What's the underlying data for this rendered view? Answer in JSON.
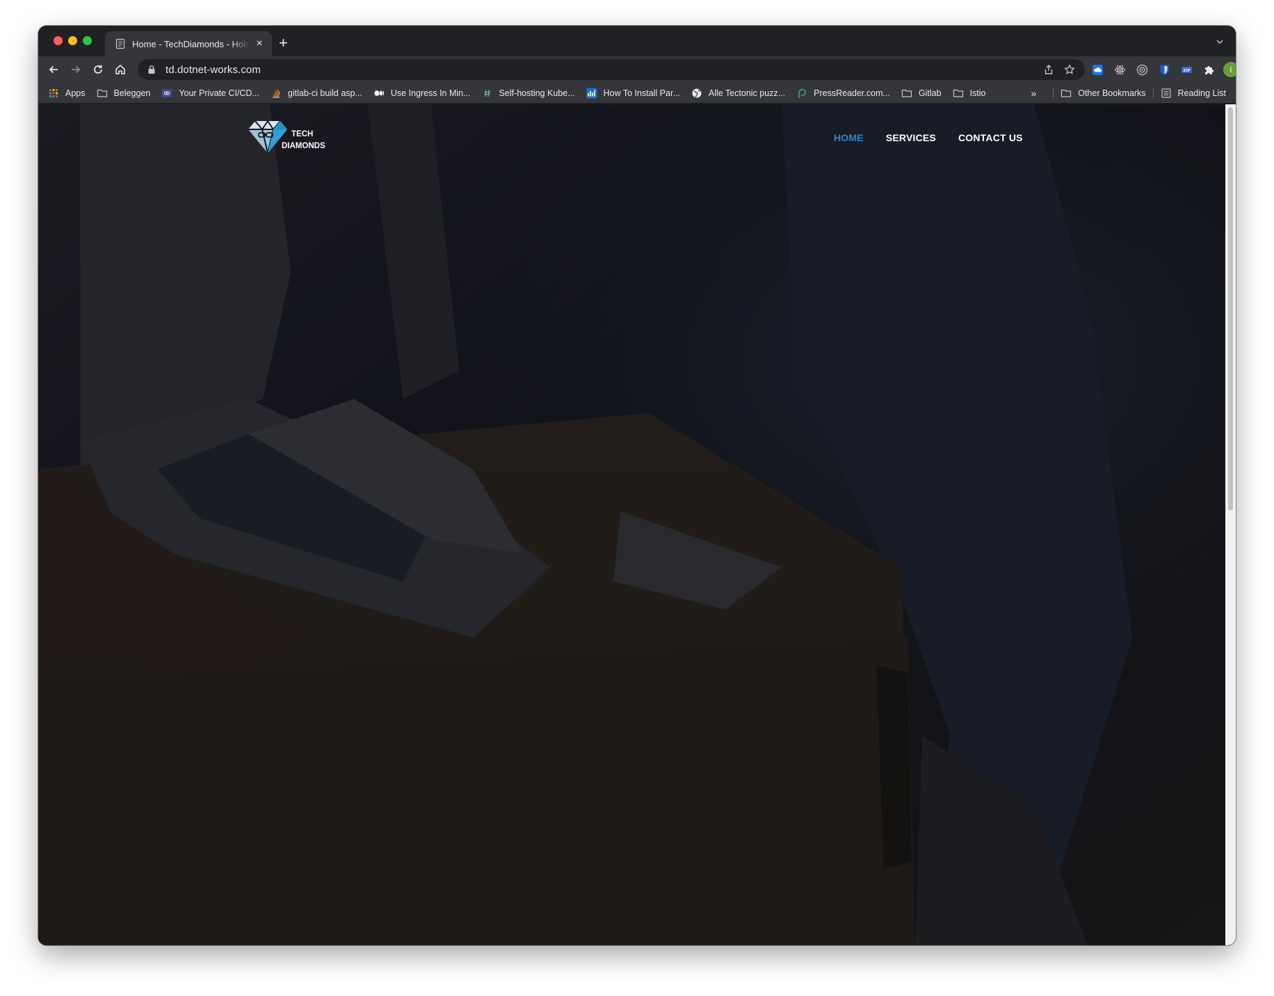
{
  "browser": {
    "tab": {
      "title": "Home - TechDiamonds - Hold",
      "close_label": "×"
    },
    "new_tab_label": "+",
    "address": {
      "url": "td.dotnet-works.com"
    },
    "avatar_initial": "i",
    "bookmarks": [
      {
        "label": "Apps",
        "icon": "apps-grid-icon"
      },
      {
        "label": "Beleggen",
        "icon": "folder-icon"
      },
      {
        "label": "Your Private CI/CD...",
        "icon": "infinity-icon"
      },
      {
        "label": "gitlab-ci build asp...",
        "icon": "stack-icon"
      },
      {
        "label": "Use Ingress In Min...",
        "icon": "medium-icon"
      },
      {
        "label": "Self-hosting Kube...",
        "icon": "hash-icon"
      },
      {
        "label": "How To Install Par...",
        "icon": "chart-icon"
      },
      {
        "label": "Alle Tectonic puzz...",
        "icon": "globe-icon"
      },
      {
        "label": "PressReader.com...",
        "icon": "pressreader-icon"
      },
      {
        "label": "Gitlab",
        "icon": "folder-icon"
      },
      {
        "label": "Istio",
        "icon": "folder-icon"
      }
    ],
    "more_bookmarks_label": "»",
    "other_bookmarks": "Other Bookmarks",
    "reading_list": "Reading List"
  },
  "site": {
    "logo": {
      "line1": "TECH",
      "line2": "DIAMONDS"
    },
    "nav": [
      {
        "label": "HOME",
        "active": true
      },
      {
        "label": "SERVICES",
        "active": false
      },
      {
        "label": "CONTACT US",
        "active": false
      }
    ],
    "colors": {
      "nav_active": "#1e8bd6",
      "nav": "#ffffff"
    }
  }
}
